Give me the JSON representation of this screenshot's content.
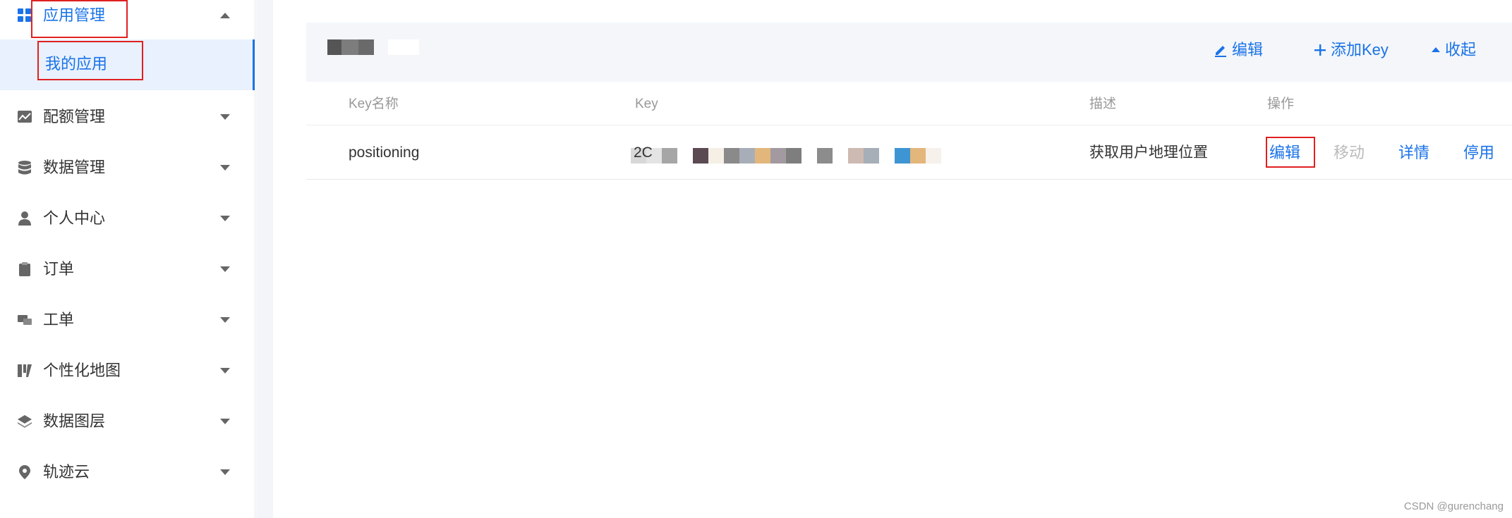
{
  "sidebar": {
    "items": [
      {
        "label": "应用管理",
        "icon": "grid-icon",
        "expanded": true
      },
      {
        "label": "配额管理",
        "icon": "chart-icon"
      },
      {
        "label": "数据管理",
        "icon": "database-icon"
      },
      {
        "label": "个人中心",
        "icon": "user-icon"
      },
      {
        "label": "订单",
        "icon": "clipboard-icon"
      },
      {
        "label": "工单",
        "icon": "ticket-icon"
      },
      {
        "label": "个性化地图",
        "icon": "map-style-icon"
      },
      {
        "label": "数据图层",
        "icon": "layers-icon"
      },
      {
        "label": "轨迹云",
        "icon": "location-icon"
      }
    ],
    "submenu": {
      "label": "我的应用"
    }
  },
  "card": {
    "actions": {
      "edit": "编辑",
      "add_key": "添加Key",
      "collapse": "收起"
    }
  },
  "table": {
    "headers": {
      "key_name": "Key名称",
      "key": "Key",
      "description": "描述",
      "actions": "操作"
    },
    "rows": [
      {
        "key_name": "positioning",
        "key_prefix": "2C",
        "description": "获取用户地理位置",
        "actions": {
          "edit": "编辑",
          "move": "移动",
          "details": "详情",
          "disable": "停用"
        }
      }
    ]
  },
  "watermark": "CSDN @gurenchang",
  "colors": {
    "accent": "#1a73e8",
    "highlight_box": "#e02020",
    "selected_bg": "#e8f1fd"
  }
}
